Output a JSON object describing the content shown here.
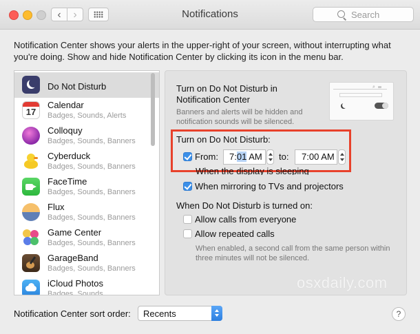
{
  "window": {
    "title": "Notifications",
    "search_placeholder": "Search"
  },
  "toolbar": {
    "back_glyph": "‹",
    "forward_glyph": "›"
  },
  "description": "Notification Center shows your alerts in the upper-right of your screen, without interrupting what you're doing. Show and hide Notification Center by clicking its icon in the menu bar.",
  "sidebar": {
    "items": [
      {
        "name": "Do Not Disturb",
        "subtitle": "",
        "icon": "moon-icon",
        "selected": true
      },
      {
        "name": "Calendar",
        "subtitle": "Badges, Sounds, Alerts",
        "icon": "calendar-icon",
        "icon_text": "17"
      },
      {
        "name": "Colloquy",
        "subtitle": "Badges, Sounds, Banners",
        "icon": "colloquy-icon"
      },
      {
        "name": "Cyberduck",
        "subtitle": "Badges, Sounds, Banners",
        "icon": "duck-icon"
      },
      {
        "name": "FaceTime",
        "subtitle": "Badges, Sounds, Banners",
        "icon": "facetime-icon"
      },
      {
        "name": "Flux",
        "subtitle": "Badges, Sounds, Banners",
        "icon": "flux-icon"
      },
      {
        "name": "Game Center",
        "subtitle": "Badges, Sounds, Banners",
        "icon": "game-center-icon"
      },
      {
        "name": "GarageBand",
        "subtitle": "Badges, Sounds, Banners",
        "icon": "guitar-icon"
      },
      {
        "name": "iCloud Photos",
        "subtitle": "Badges, Sounds",
        "icon": "icloud-icon"
      }
    ]
  },
  "panel": {
    "title": "Turn on Do Not Disturb in Notification Center",
    "subtitle": "Banners and alerts will be hidden and notification sounds will be silenced.",
    "schedule_label": "Turn on Do Not Disturb:",
    "from_label": "From:",
    "from_hour": "7:",
    "from_minute": "01",
    "from_ampm": " AM",
    "to_label": "to:",
    "to_time": "7:00 AM",
    "from_checked": true,
    "display_sleeping_label": "When the display is sleeping",
    "mirroring_label": "When mirroring to TVs and projectors",
    "mirroring_checked": true,
    "section_title": "When Do Not Disturb is turned on:",
    "allow_calls_label": "Allow calls from everyone",
    "allow_calls_checked": false,
    "repeated_calls_label": "Allow repeated calls",
    "repeated_calls_checked": false,
    "repeated_calls_note": "When enabled, a second call from the same person within three minutes will not be silenced."
  },
  "footer": {
    "sort_label": "Notification Center sort order:",
    "sort_value": "Recents",
    "help_label": "?"
  },
  "watermark": "osxdaily.com",
  "colors": {
    "highlight_box": "#e8412b",
    "checkbox_on": "#3b8fe8"
  }
}
